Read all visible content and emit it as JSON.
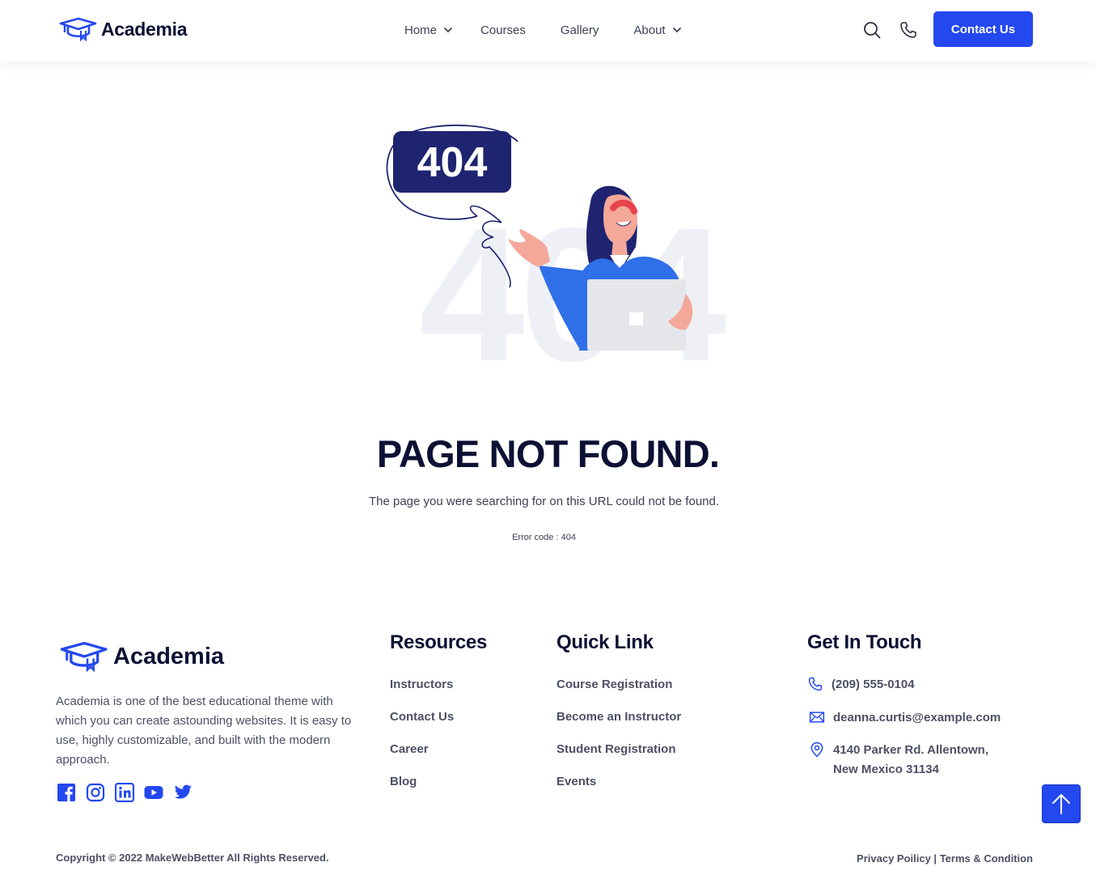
{
  "brand": {
    "name": "Academia"
  },
  "nav": {
    "items": [
      {
        "label": "Home",
        "has_dropdown": true
      },
      {
        "label": "Courses",
        "has_dropdown": false
      },
      {
        "label": "Gallery",
        "has_dropdown": false
      },
      {
        "label": "About",
        "has_dropdown": true
      }
    ],
    "icons": [
      "search-icon",
      "phone-icon"
    ],
    "contact_button": "Contact Us"
  },
  "hero": {
    "badge_text": "404",
    "watermark_text": "404",
    "title": "PAGE NOT FOUND.",
    "subtitle": "The page you were searching for on this URL could not be found.",
    "error_code": "Error code : 404"
  },
  "footer": {
    "brand": "Academia",
    "about": "Academia is one of the best educational theme with which you can create astounding websites. It is easy to use, highly customizable, and built with the modern approach.",
    "socials": [
      "facebook-icon",
      "instagram-icon",
      "linkedin-icon",
      "youtube-icon",
      "twitter-icon"
    ],
    "resources": {
      "title": "Resources",
      "links": [
        "Instructors",
        "Contact Us",
        "Career",
        "Blog"
      ]
    },
    "quick_link": {
      "title": "Quick Link",
      "links": [
        "Course Registration",
        "Become an Instructor",
        "Student Registration",
        "Events"
      ]
    },
    "get_in_touch": {
      "title": "Get In Touch",
      "phone": "(209) 555-0104",
      "email": "deanna.curtis@example.com",
      "address_line1": "4140 Parker Rd. Allentown,",
      "address_line2": "New Mexico 31134"
    },
    "copyright": "Copyright © 2022 MakeWebBetter All Rights Reserved.",
    "privacy": "Privacy Poilicy",
    "separator": " | ",
    "terms": "Terms & Condition"
  },
  "colors": {
    "accent": "#2448f0",
    "heading": "#0c1033",
    "body_text": "#4d5066",
    "badge_bg": "#1e2470"
  }
}
